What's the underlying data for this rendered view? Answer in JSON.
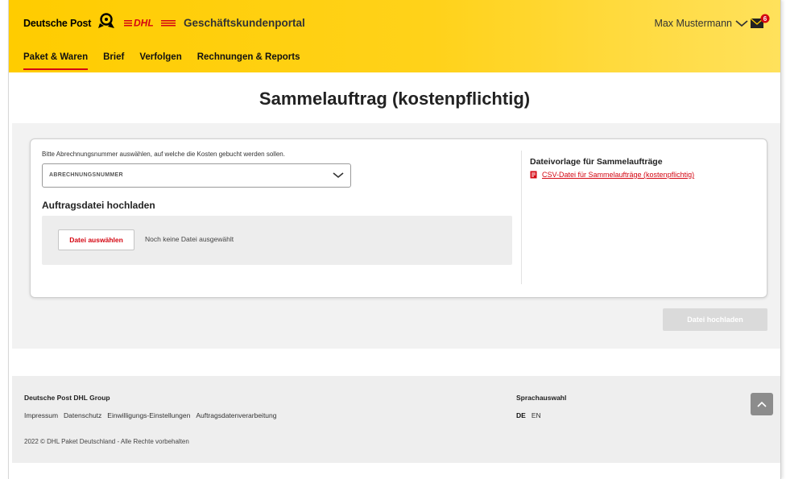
{
  "header": {
    "brand_dp": "Deutsche Post",
    "brand_dhl": "DHL",
    "portal_title": "Geschäftskundenportal",
    "user_name": "Max Mustermann",
    "mail_badge": "6"
  },
  "nav": {
    "items": [
      {
        "label": "Paket & Waren"
      },
      {
        "label": "Brief"
      },
      {
        "label": "Verfolgen"
      },
      {
        "label": "Rechnungen & Reports"
      }
    ]
  },
  "main": {
    "title": "Sammelauftrag (kostenpflichtig)",
    "account_hint": "Bitte Abrechnungsnummer auswählen, auf welche die Kosten gebucht werden sollen.",
    "account_select_placeholder": "ABRECHNUNGSNUMMER",
    "upload_title": "Auftragsdatei hochladen",
    "choose_file_label": "Datei auswählen",
    "no_file_text": "Noch keine Datei ausgewählt",
    "template_title": "Dateivorlage für Sammelaufträge",
    "template_link": "CSV-Datei für Sammelaufträge (kostenpflichtig)",
    "upload_button": "Datei hochladen"
  },
  "footer": {
    "brand": "Deutsche Post DHL Group",
    "links": [
      "Impressum",
      "Datenschutz",
      "Einwilligungs-Einstellungen",
      "Auftragsdatenverarbeitung"
    ],
    "copyright": "2022 © DHL Paket Deutschland - Alle Rechte vorbehalten",
    "language_title": "Sprachauswahl",
    "languages": [
      "DE",
      "EN"
    ]
  },
  "colors": {
    "brand_yellow": "#ffcc00",
    "brand_red": "#d40511"
  }
}
